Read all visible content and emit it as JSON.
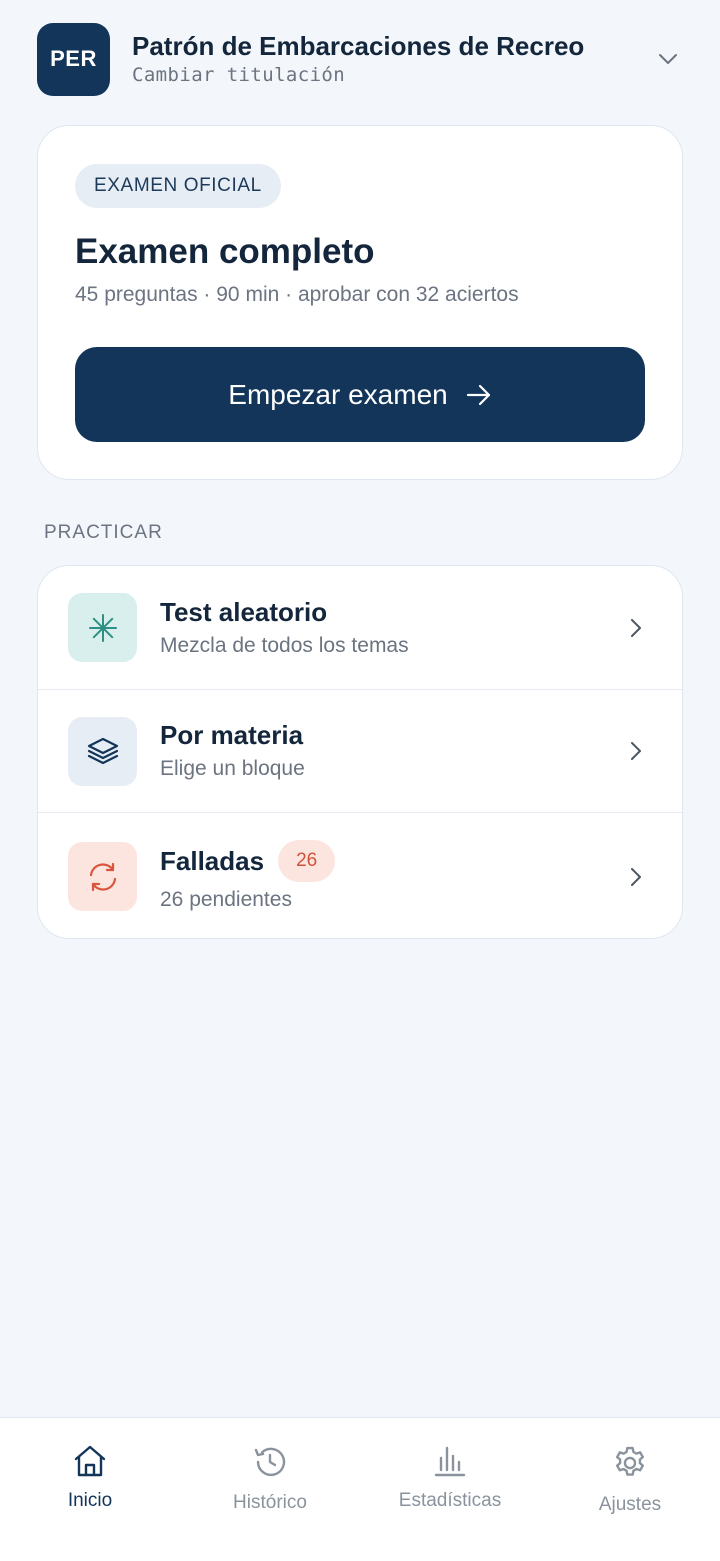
{
  "header": {
    "avatar_text": "PER",
    "title": "Patrón de Embarcaciones de Recreo",
    "subtitle": "Cambiar titulación",
    "chevron_icon": "chevron-down-icon"
  },
  "exam_card": {
    "badge": "EXAMEN OFICIAL",
    "title": "Examen completo",
    "meta": "45 preguntas · 90 min · aprobar con 32 aciertos",
    "button_label": "Empezar examen",
    "button_icon": "arrow-right-icon"
  },
  "practice": {
    "section_label": "PRACTICAR",
    "items": [
      {
        "title": "Test aleatorio",
        "subtitle": "Mezcla de todos los temas",
        "icon": "asterisk-icon",
        "icon_bg": "#d8efed",
        "icon_color": "#2e8f82"
      },
      {
        "title": "Por materia",
        "subtitle": "Elige un bloque",
        "icon": "layers-icon",
        "icon_bg": "#e6edf4",
        "icon_color": "#13355a"
      },
      {
        "title": "Falladas",
        "badge": "26",
        "subtitle": "26 pendientes",
        "icon": "refresh-icon",
        "icon_bg": "#fde5df",
        "icon_color": "#d9553c"
      }
    ]
  },
  "nav": {
    "items": [
      {
        "label": "Inicio",
        "icon": "home-icon",
        "active": true
      },
      {
        "label": "Histórico",
        "icon": "history-icon",
        "active": false
      },
      {
        "label": "Estadísticas",
        "icon": "bar-chart-icon",
        "active": false
      },
      {
        "label": "Ajustes",
        "icon": "gear-icon",
        "active": false
      }
    ]
  },
  "colors": {
    "primary": "#13355a",
    "background": "#f3f7fb",
    "text": "#13263b",
    "muted": "#6b7480",
    "danger": "#d0533b"
  }
}
